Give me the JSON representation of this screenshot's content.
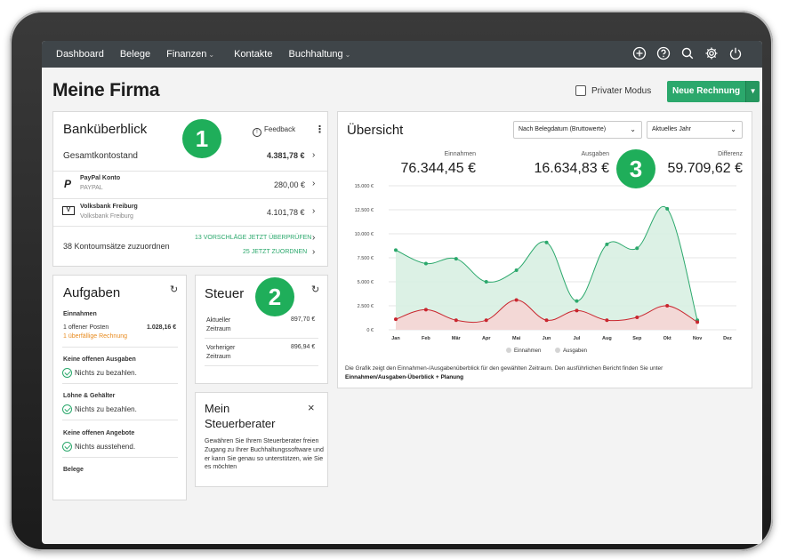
{
  "nav": {
    "items": [
      {
        "label": "Dashboard",
        "dropdown": false
      },
      {
        "label": "Belege",
        "dropdown": false
      },
      {
        "label": "Finanzen",
        "dropdown": true
      },
      {
        "label": "Kontakte",
        "dropdown": false
      },
      {
        "label": "Buchhaltung",
        "dropdown": true
      }
    ],
    "icons": [
      "plus-circle-icon",
      "help-icon",
      "search-icon",
      "gear-icon",
      "power-icon"
    ]
  },
  "page": {
    "title": "Meine Firma",
    "private_mode_label": "Privater Modus",
    "new_invoice_label": "Neue Rechnung"
  },
  "badges": {
    "one": "1",
    "two": "2",
    "three": "3"
  },
  "bank": {
    "title": "Banküberblick",
    "feedback_label": "Feedback",
    "total_label": "Gesamtkontostand",
    "total_value": "4.381,78 €",
    "accounts": [
      {
        "name": "PayPal Konto",
        "sub": "PAYPAL",
        "value": "280,00 €",
        "icon": "paypal-icon"
      },
      {
        "name": "Volksbank Freiburg",
        "sub": "Volksbank Freiburg",
        "value": "4.101,78 €",
        "icon": "volksbank-icon"
      }
    ],
    "unassigned_label": "38 Kontoumsätze zuzuordnen",
    "suggestions_link": "13 VORSCHLÄGE JETZT ÜBERPRÜFEN",
    "assign_link": "25 JETZT ZUORDNEN"
  },
  "tasks": {
    "title": "Aufgaben",
    "income_heading": "Einnahmen",
    "open_items_label": "1 offener Posten",
    "open_items_value": "1.028,16 €",
    "overdue_label": "1 überfällige Rechnung",
    "expenses_heading": "Keine offenen Ausgaben",
    "expenses_status": "Nichts zu bezahlen.",
    "salaries_heading": "Löhne & Gehälter",
    "salaries_status": "Nichts zu bezahlen.",
    "offers_heading": "Keine offenen Angebote",
    "offers_status": "Nichts ausstehend.",
    "receipts_heading": "Belege"
  },
  "tax": {
    "title": "Steuer",
    "current_label": "Aktueller Zeitraum",
    "current_value": "897,70 €",
    "previous_label": "Vorheriger Zeitraum",
    "previous_value": "896,94 €"
  },
  "advisor": {
    "title": "Mein Steuerberater",
    "text": "Gewähren Sie Ihrem Steuerberater freien Zugang zu Ihrer Buchhaltungssoftware und er kann Sie genau so unterstützen, wie Sie es möchten"
  },
  "overview": {
    "title": "Übersicht",
    "filter_basis": "Nach Belegdatum (Bruttowerte)",
    "filter_period": "Aktuelles Jahr",
    "income_label": "Einnahmen",
    "income_value": "76.344,45 €",
    "expense_label": "Ausgaben",
    "expense_value": "16.634,83 €",
    "difference_label": "Differenz",
    "difference_value": "59.709,62 €",
    "footnote": "Die Grafik zeigt den Einnahmen-/Ausgabenüberblick für den gewählten Zeitraum. Den ausführlichen Bericht finden Sie unter",
    "footnote_link": "Einnahmen/Ausgaben-Überblick + Planung"
  },
  "colors": {
    "accent": "#2ba86c",
    "income_line": "#2ba86c",
    "income_fill": "#d6efe0",
    "expense_line": "#c9262e",
    "expense_fill": "#f7d4d4",
    "nav_bg": "#3f4549",
    "warning": "#e88b1f"
  },
  "chart_data": {
    "type": "area",
    "categories": [
      "Jan",
      "Feb",
      "Mär",
      "Apr",
      "Mai",
      "Jun",
      "Jul",
      "Aug",
      "Sep",
      "Okt",
      "Nov",
      "Dez"
    ],
    "series": [
      {
        "name": "Einnahmen",
        "values": [
          8300,
          6900,
          7400,
          5000,
          6200,
          9100,
          3000,
          8900,
          8500,
          12600,
          1000,
          null
        ]
      },
      {
        "name": "Ausgaben",
        "values": [
          1100,
          2100,
          1000,
          1000,
          3100,
          1000,
          2000,
          1000,
          1300,
          2500,
          800,
          null
        ]
      }
    ],
    "yticks": [
      "15.000 €",
      "12.500 €",
      "10.000 €",
      "7.500 €",
      "5.000 €",
      "2.500 €",
      "0 €"
    ],
    "ylim": [
      0,
      15000
    ],
    "legend": "bottom",
    "grid": true
  }
}
